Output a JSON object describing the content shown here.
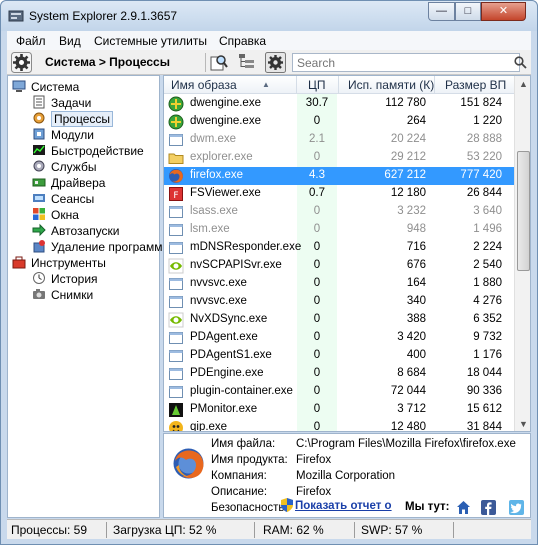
{
  "window": {
    "title": "System Explorer 2.9.1.3657"
  },
  "menu": [
    "Файл",
    "Вид",
    "Системные утилиты",
    "Справка"
  ],
  "toolbar": {
    "breadcrumb": "Система > Процессы",
    "search_placeholder": "Search"
  },
  "tree": [
    {
      "label": "Система",
      "icon": "computer-icon",
      "level": 0
    },
    {
      "label": "Задачи",
      "icon": "tasks-icon",
      "level": 1
    },
    {
      "label": "Процессы",
      "icon": "processes-icon",
      "level": 1,
      "selected": true
    },
    {
      "label": "Модули",
      "icon": "modules-icon",
      "level": 1
    },
    {
      "label": "Быстродействие",
      "icon": "performance-icon",
      "level": 1
    },
    {
      "label": "Службы",
      "icon": "services-icon",
      "level": 1
    },
    {
      "label": "Драйвера",
      "icon": "drivers-icon",
      "level": 1
    },
    {
      "label": "Сеансы",
      "icon": "sessions-icon",
      "level": 1
    },
    {
      "label": "Окна",
      "icon": "windows-icon",
      "level": 1
    },
    {
      "label": "Автозапуски",
      "icon": "autoruns-icon",
      "level": 1
    },
    {
      "label": "Удаление программ",
      "icon": "uninstall-icon",
      "level": 1
    },
    {
      "label": "Инструменты",
      "icon": "toolbox-icon",
      "level": 0
    },
    {
      "label": "История",
      "icon": "history-icon",
      "level": 1
    },
    {
      "label": "Снимки",
      "icon": "snapshots-icon",
      "level": 1
    }
  ],
  "columns": {
    "name": "Имя образа",
    "cpu": "ЦП",
    "mem": "Исп. памяти (К)",
    "vm": "Размер ВП"
  },
  "processes": [
    {
      "name": "dwengine.exe",
      "cpu": "30.7",
      "mem": "112 780",
      "vm": "151 824",
      "icon": "shield-green-icon"
    },
    {
      "name": "dwengine.exe",
      "cpu": "0",
      "mem": "264",
      "vm": "1 220",
      "icon": "shield-green-icon"
    },
    {
      "name": "dwm.exe",
      "cpu": "2.1",
      "mem": "20 224",
      "vm": "28 888",
      "icon": "window-icon",
      "dim": true
    },
    {
      "name": "explorer.exe",
      "cpu": "0",
      "mem": "29 212",
      "vm": "53 220",
      "icon": "folder-icon",
      "dim": true
    },
    {
      "name": "firefox.exe",
      "cpu": "4.3",
      "mem": "627 212",
      "vm": "777 420",
      "icon": "firefox-icon",
      "selected": true
    },
    {
      "name": "FSViewer.exe",
      "cpu": "0.7",
      "mem": "12 180",
      "vm": "26 844",
      "icon": "fsviewer-icon"
    },
    {
      "name": "lsass.exe",
      "cpu": "0",
      "mem": "3 232",
      "vm": "3 640",
      "icon": "window-icon",
      "dim": true
    },
    {
      "name": "lsm.exe",
      "cpu": "0",
      "mem": "948",
      "vm": "1 496",
      "icon": "window-icon",
      "dim": true
    },
    {
      "name": "mDNSResponder.exe",
      "cpu": "0",
      "mem": "716",
      "vm": "2 224",
      "icon": "window-icon"
    },
    {
      "name": "nvSCPAPISvr.exe",
      "cpu": "0",
      "mem": "676",
      "vm": "2 540",
      "icon": "nvidia-icon"
    },
    {
      "name": "nvvsvc.exe",
      "cpu": "0",
      "mem": "164",
      "vm": "1 880",
      "icon": "window-icon"
    },
    {
      "name": "nvvsvc.exe",
      "cpu": "0",
      "mem": "340",
      "vm": "4 276",
      "icon": "window-icon"
    },
    {
      "name": "NvXDSync.exe",
      "cpu": "0",
      "mem": "388",
      "vm": "6 352",
      "icon": "nvidia-icon"
    },
    {
      "name": "PDAgent.exe",
      "cpu": "0",
      "mem": "3 420",
      "vm": "9 732",
      "icon": "window-icon"
    },
    {
      "name": "PDAgentS1.exe",
      "cpu": "0",
      "mem": "400",
      "vm": "1 176",
      "icon": "window-icon"
    },
    {
      "name": "PDEngine.exe",
      "cpu": "0",
      "mem": "8 684",
      "vm": "18 044",
      "icon": "window-icon"
    },
    {
      "name": "plugin-container.exe",
      "cpu": "0",
      "mem": "72 044",
      "vm": "90 336",
      "icon": "window-icon"
    },
    {
      "name": "PMonitor.exe",
      "cpu": "0",
      "mem": "3 712",
      "vm": "15 612",
      "icon": "pmonitor-icon"
    },
    {
      "name": "qip.exe",
      "cpu": "0",
      "mem": "12 480",
      "vm": "31 844",
      "icon": "qip-icon"
    }
  ],
  "details": {
    "file_label": "Имя файла:",
    "file_value": "C:\\Program Files\\Mozilla Firefox\\firefox.exe",
    "product_label": "Имя продукта:",
    "product_value": "Firefox",
    "company_label": "Компания:",
    "company_value": "Mozilla Corporation",
    "description_label": "Описание:",
    "description_value": "Firefox",
    "security_label": "Безопасность:",
    "report_link": "Показать отчет о",
    "we_here": "Мы тут:"
  },
  "status": {
    "processes": "Процессы: 59",
    "cpu_load": "Загрузка ЦП: 52 %",
    "ram": "RAM: 62 %",
    "swp": "SWP: 57 %"
  },
  "colors": {
    "selection": "#3399ff",
    "cpu_column": "#edfdf2",
    "link": "#1a3fa8"
  }
}
